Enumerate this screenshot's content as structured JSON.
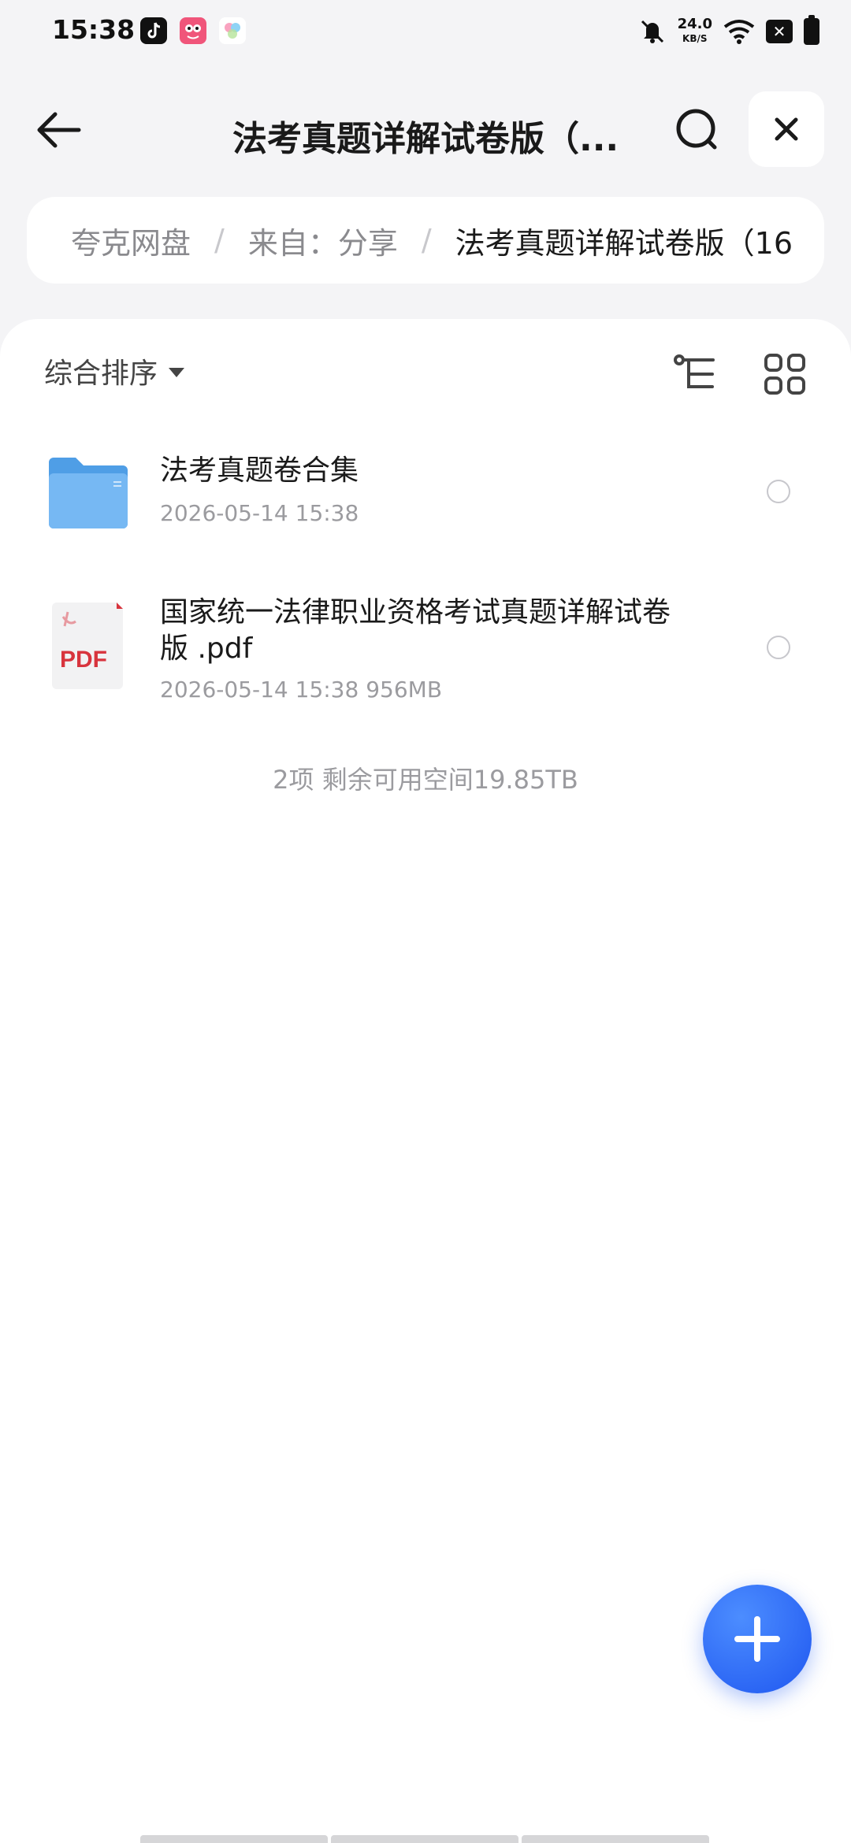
{
  "status_bar": {
    "time": "15:38",
    "net_speed_value": "24.0",
    "net_speed_unit": "KB/S",
    "icons": [
      "tiktok-icon",
      "app-icon",
      "app-icon",
      "mute-icon",
      "wifi-icon",
      "close-box-icon",
      "battery-icon"
    ]
  },
  "header": {
    "title": "法考真题详解试卷版（..."
  },
  "breadcrumb": {
    "items": [
      "夸克网盘",
      "来自：分享",
      "法考真题详解试卷版（16"
    ],
    "separator": "/"
  },
  "toolbar": {
    "sort_label": "综合排序"
  },
  "files": [
    {
      "name": "法考真题卷合集",
      "meta": "2026-05-14 15:38",
      "type": "folder"
    },
    {
      "name": "国家统一法律职业资格考试真题详解试卷版 .pdf",
      "meta": "2026-05-14 15:38  956MB",
      "type": "pdf",
      "icon_label": "PDF"
    }
  ],
  "summary": "2项 剩余可用空间19.85TB",
  "colors": {
    "accent": "#2563eb",
    "folder": "#5aa8ee",
    "pdf_red": "#d8343d"
  }
}
